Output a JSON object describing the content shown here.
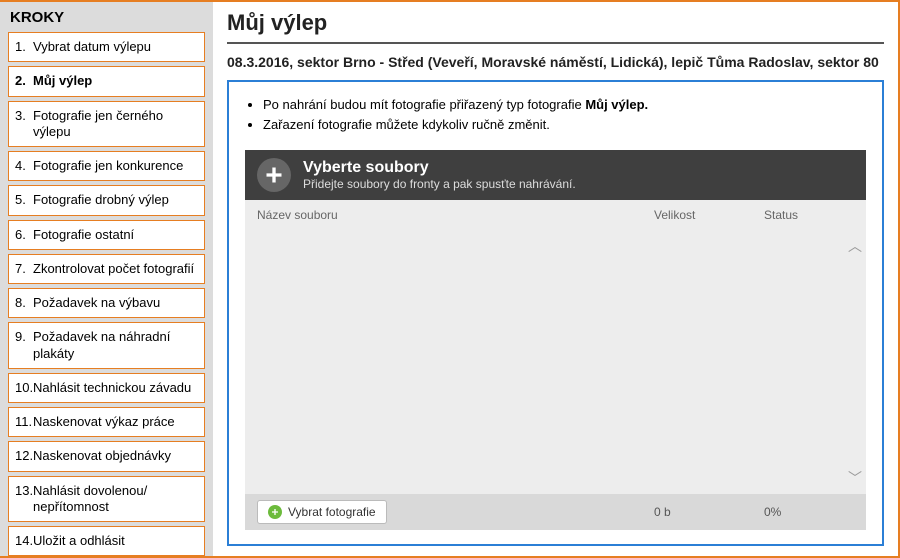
{
  "sidebar": {
    "title": "KROKY",
    "active_index": 1,
    "items": [
      {
        "num": "1.",
        "label": "Vybrat datum výlepu"
      },
      {
        "num": "2.",
        "label": "Můj výlep"
      },
      {
        "num": "3.",
        "label": "Fotografie jen černého výlepu"
      },
      {
        "num": "4.",
        "label": "Fotografie jen konkurence"
      },
      {
        "num": "5.",
        "label": "Fotografie drobný výlep"
      },
      {
        "num": "6.",
        "label": "Fotografie ostatní"
      },
      {
        "num": "7.",
        "label": "Zkontrolovat počet fotografií"
      },
      {
        "num": "8.",
        "label": "Požadavek na výbavu"
      },
      {
        "num": "9.",
        "label": "Požadavek na náhradní plakáty"
      },
      {
        "num": "10.",
        "label": "Nahlásit technickou závadu"
      },
      {
        "num": "11.",
        "label": "Naskenovat výkaz práce"
      },
      {
        "num": "12.",
        "label": "Naskenovat objednávky"
      },
      {
        "num": "13.",
        "label": "Nahlásit dovolenou/ nepřítomnost"
      },
      {
        "num": "14.",
        "label": "Uložit a odhlásit"
      }
    ]
  },
  "main": {
    "title": "Můj výlep",
    "subtitle": "08.3.2016, sektor Brno - Střed (Veveří, Moravské náměstí, Lidická), lepič Tůma Radoslav, sektor 80",
    "notes": {
      "line1_pre": "Po nahrání budou mít fotografie přiřazený typ fotografie ",
      "line1_bold": "Můj výlep.",
      "line2": "Zařazení fotografie můžete kdykoliv ručně změnit."
    },
    "uploader": {
      "heading": "Vyberte soubory",
      "subheading": "Přidejte soubory do fronty a pak spusťte nahrávání.",
      "col_name": "Název souboru",
      "col_size": "Velikost",
      "col_status": "Status",
      "button_label": "Vybrat fotografie",
      "total_size": "0 b",
      "total_progress": "0%"
    }
  }
}
